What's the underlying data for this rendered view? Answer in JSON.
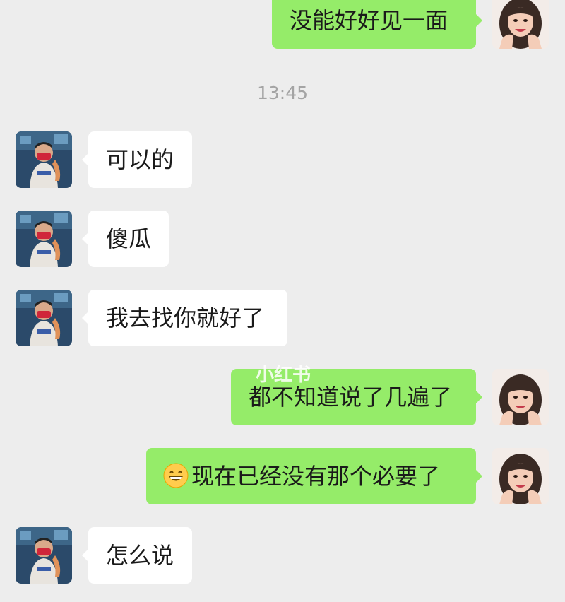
{
  "time_divider": "13:45",
  "watermark": "小红书",
  "messages": [
    {
      "side": "right",
      "text": "没能好好见一面"
    },
    {
      "side": "left",
      "text": "可以的"
    },
    {
      "side": "left",
      "text": "傻瓜"
    },
    {
      "side": "left",
      "text": "我去找你就好了"
    },
    {
      "side": "right",
      "text": "都不知道说了几遍了"
    },
    {
      "side": "right",
      "emoji": "grinning-face-emoji",
      "text": "现在已经没有那个必要了"
    },
    {
      "side": "left",
      "text": "怎么说"
    }
  ],
  "colors": {
    "background": "#ededed",
    "sent_bubble": "#95ec69",
    "received_bubble": "#ffffff",
    "time_text": "#a4a4a4"
  }
}
